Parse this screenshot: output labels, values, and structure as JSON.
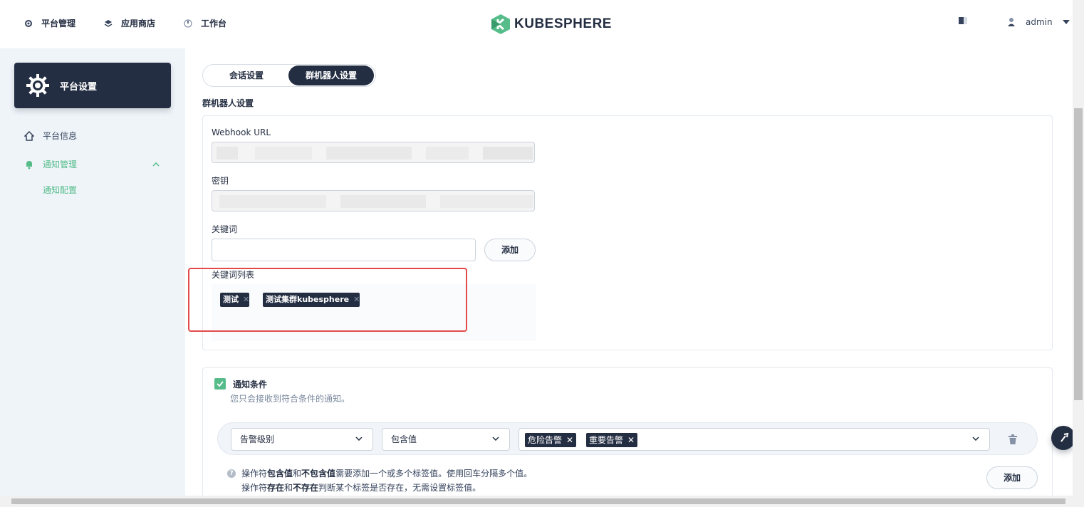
{
  "topnav": {
    "items": [
      {
        "label": "平台管理",
        "icon": "gear-icon"
      },
      {
        "label": "应用商店",
        "icon": "stack-icon"
      },
      {
        "label": "工作台",
        "icon": "dashboard-icon"
      }
    ],
    "logo_text": "KUBESPHERE",
    "user": "admin"
  },
  "sidebar": {
    "header": "平台设置",
    "items": [
      {
        "label": "平台信息",
        "icon": "home-icon"
      },
      {
        "label": "通知管理",
        "icon": "bell-icon"
      }
    ],
    "sub_item": "通知配置"
  },
  "tabs": [
    "会话设置",
    "群机器人设置"
  ],
  "section_title": "群机器人设置",
  "form": {
    "webhook_label": "Webhook URL",
    "secret_label": "密钥",
    "keyword_label": "关键词",
    "keyword_value": "",
    "add_button": "添加",
    "keyword_list_label": "关键词列表",
    "keywords": [
      "测试",
      "测试集群kubesphere"
    ]
  },
  "conditions": {
    "title": "通知条件",
    "description": "您只会接收到符合条件的通知。",
    "field_select": "告警级别",
    "operator_select": "包含值",
    "values": [
      "危险告警",
      "重要告警"
    ],
    "help_line1_parts": [
      "操作符",
      "包含值",
      "和",
      "不包含值",
      "需要添加一个或多个标签值。使用回车分隔多个值。"
    ],
    "help_line2_parts": [
      "操作符",
      "存在",
      "和",
      "不存在",
      "判断某个标签是否存在，无需设置标签值。"
    ],
    "add_button": "添加"
  },
  "colors": {
    "accent": "#55bc8a",
    "dark": "#242e42",
    "highlight": "#e34b4b"
  }
}
